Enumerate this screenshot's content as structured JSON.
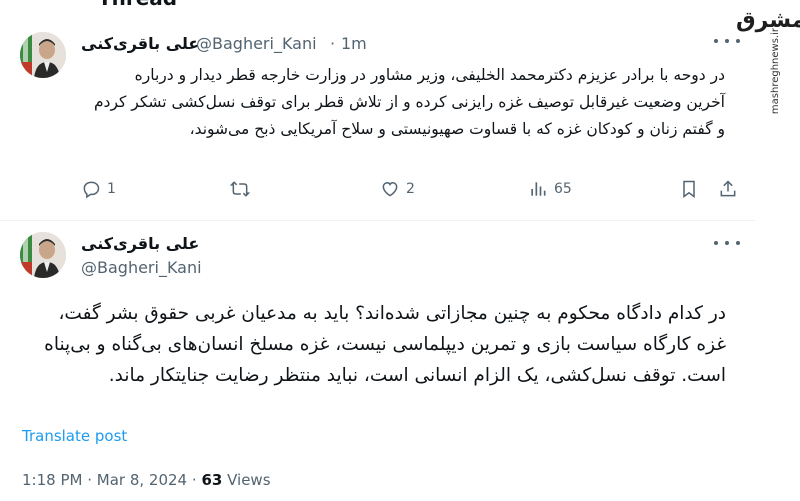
{
  "header_partial": "Thread",
  "watermark": {
    "logo": "مشرق",
    "url": "mashreghnews.ir"
  },
  "tweet1": {
    "name": "علی باقری‌کنی",
    "handle": "@Bagheri_Kani",
    "separator": "·",
    "time": "1m",
    "text": "در دوحه با برادر عزیزم دکترمحمد الخلیفی، وزیر مشاور در وزارت خارجه قطر دیدار و درباره آخرین وضعیت غیرقابل توصیف غزه رایزنی کرده و از تلاش قطر برای توقف نسل‌کشی تشکر کردم و گفتم زنان و کودکان غزه که با قساوت صهیونیستی و سلاح آمریکایی ذبح می‌شوند،",
    "actions": {
      "replies": "1",
      "reposts": "",
      "likes": "2",
      "views": "65"
    }
  },
  "tweet2": {
    "name": "علی باقری‌کنی",
    "handle": "@Bagheri_Kani",
    "text": "در کدام دادگاه محکوم به چنین مجازاتی شده‌اند؟ باید به مدعیان غربی حقوق بشر گفت، غزه کارگاه سیاست بازی و تمرین دیپلماسی نیست، غزه مسلخ انسان‌های بی‌گناه و بی‌پناه است. توقف نسل‌کشی، یک الزام انسانی است، نباید منتظر رضایت جنایتکار ماند.",
    "translate": "Translate post",
    "time": "1:18 PM",
    "date": "Mar 8, 2024",
    "views_count": "63",
    "views_label": "Views"
  },
  "colors": {
    "text": "#0f1419",
    "secondary": "#536471",
    "link": "#1d9bf0",
    "divider": "#eff3f4"
  }
}
